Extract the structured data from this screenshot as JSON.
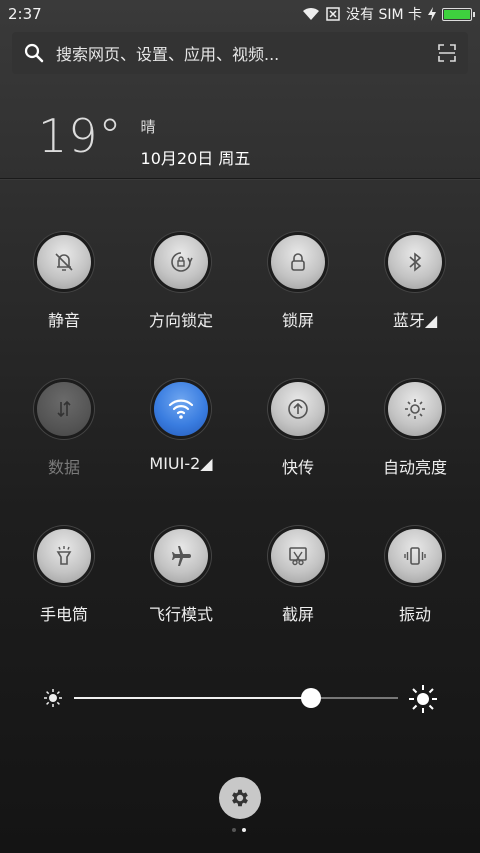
{
  "status_bar": {
    "time": "2:37",
    "carrier": "没有 SIM 卡",
    "battery_level": 1.0
  },
  "search": {
    "placeholder": "搜索网页、设置、应用、视频..."
  },
  "weather": {
    "temperature": "19°",
    "condition": "晴",
    "date": "10月20日 周五"
  },
  "tiles": [
    {
      "label": "静音",
      "icon": "bell-mute-icon",
      "state": "off"
    },
    {
      "label": "方向锁定",
      "icon": "rotation-lock-icon",
      "state": "off"
    },
    {
      "label": "锁屏",
      "icon": "lock-icon",
      "state": "off"
    },
    {
      "label": "蓝牙◢",
      "icon": "bluetooth-icon",
      "state": "off"
    },
    {
      "label": "数据",
      "icon": "data-arrows-icon",
      "state": "disabled"
    },
    {
      "label": "MIUI-2◢",
      "icon": "wifi-icon",
      "state": "on"
    },
    {
      "label": "快传",
      "icon": "upload-icon",
      "state": "off"
    },
    {
      "label": "自动亮度",
      "icon": "sun-icon",
      "state": "off"
    },
    {
      "label": "手电筒",
      "icon": "flashlight-icon",
      "state": "off"
    },
    {
      "label": "飞行模式",
      "icon": "airplane-icon",
      "state": "off"
    },
    {
      "label": "截屏",
      "icon": "screenshot-icon",
      "state": "off"
    },
    {
      "label": "振动",
      "icon": "vibrate-icon",
      "state": "off"
    }
  ],
  "brightness": {
    "level": 0.73
  },
  "page_indicator": {
    "count": 2,
    "current": 1
  },
  "colors": {
    "accent_on": "#3a7de0",
    "battery_green": "#3ed13e"
  }
}
